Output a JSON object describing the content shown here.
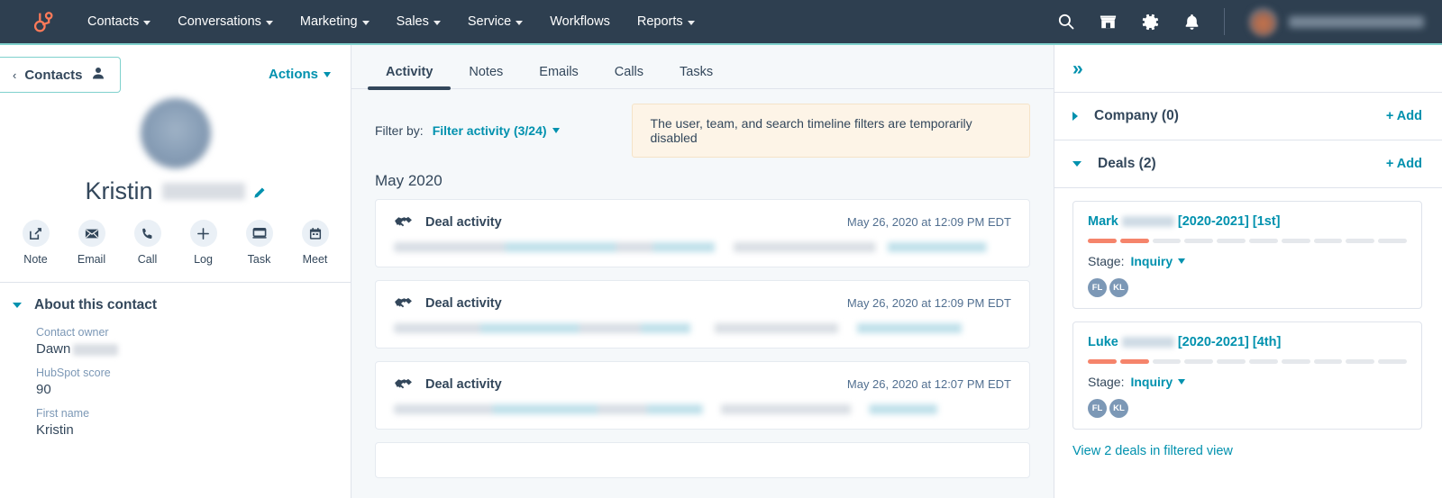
{
  "topnav": {
    "logo_icon": "hubspot-sprocket-logo",
    "items": [
      {
        "label": "Contacts",
        "has_caret": true
      },
      {
        "label": "Conversations",
        "has_caret": true
      },
      {
        "label": "Marketing",
        "has_caret": true
      },
      {
        "label": "Sales",
        "has_caret": true
      },
      {
        "label": "Service",
        "has_caret": true
      },
      {
        "label": "Workflows",
        "has_caret": false
      },
      {
        "label": "Reports",
        "has_caret": true
      }
    ],
    "icons": [
      "search-icon",
      "marketplace-icon",
      "settings-gear-icon",
      "notifications-bell-icon"
    ],
    "background_color": "#2e3f50",
    "underline_color": "#7fd1cd"
  },
  "left_panel": {
    "back_button": {
      "label": "Contacts",
      "icon": "contact-person-icon"
    },
    "actions_button": {
      "label": "Actions"
    },
    "contact": {
      "first_name": "Kristin",
      "last_name_redacted": true,
      "edit_icon": "pencil-edit-icon"
    },
    "quick_actions": [
      {
        "label": "Note",
        "icon": "note-icon"
      },
      {
        "label": "Email",
        "icon": "email-envelope-icon"
      },
      {
        "label": "Call",
        "icon": "phone-icon"
      },
      {
        "label": "Log",
        "icon": "plus-icon"
      },
      {
        "label": "Task",
        "icon": "task-icon"
      },
      {
        "label": "Meet",
        "icon": "calendar-icon"
      }
    ],
    "about": {
      "title": "About this contact",
      "properties": [
        {
          "label": "Contact owner",
          "value": "Dawn",
          "redacted": true
        },
        {
          "label": "HubSpot score",
          "value": "90",
          "redacted": false
        },
        {
          "label": "First name",
          "value": "Kristin",
          "redacted": false
        }
      ]
    }
  },
  "center_panel": {
    "tabs": [
      {
        "label": "Activity",
        "active": true
      },
      {
        "label": "Notes",
        "active": false
      },
      {
        "label": "Emails",
        "active": false
      },
      {
        "label": "Calls",
        "active": false
      },
      {
        "label": "Tasks",
        "active": false
      }
    ],
    "filter": {
      "prefix": "Filter by:",
      "link_label": "Filter activity (3/24)"
    },
    "banner": {
      "message": "The user, team, and search timeline filters are temporarily disabled",
      "background_color": "#fdf4e7"
    },
    "timeline": {
      "month_header": "May 2020",
      "activities": [
        {
          "title": "Deal activity",
          "timestamp": "May 26, 2020 at 12:09 PM EDT",
          "icon": "handshake-deal-icon"
        },
        {
          "title": "Deal activity",
          "timestamp": "May 26, 2020 at 12:09 PM EDT",
          "icon": "handshake-deal-icon"
        },
        {
          "title": "Deal activity",
          "timestamp": "May 26, 2020 at 12:07 PM EDT",
          "icon": "handshake-deal-icon"
        }
      ]
    }
  },
  "right_panel": {
    "collapse_icon": "double-chevron-right-icon",
    "sections": [
      {
        "title": "Company (0)",
        "add_label": "+ Add",
        "expanded": false
      },
      {
        "title": "Deals (2)",
        "add_label": "+ Add",
        "expanded": true
      }
    ],
    "deals": [
      {
        "name_prefix": "Mark",
        "name_suffix": "[2020-2021] [1st]",
        "stage_label": "Stage:",
        "stage_value": "Inquiry",
        "stage_segments_total": 10,
        "stage_segments_filled": 2,
        "owners": [
          "FL",
          "KL"
        ]
      },
      {
        "name_prefix": "Luke",
        "name_suffix": "[2020-2021] [4th]",
        "stage_label": "Stage:",
        "stage_value": "Inquiry",
        "stage_segments_total": 10,
        "stage_segments_filled": 2,
        "owners": [
          "FL",
          "KL"
        ]
      }
    ],
    "view_deals_link": "View 2 deals in filtered view"
  },
  "colors": {
    "accent_teal": "#0091ae",
    "dark_slate": "#33475b",
    "salmon": "#f5846b",
    "page_bg": "#f5f8fa"
  }
}
